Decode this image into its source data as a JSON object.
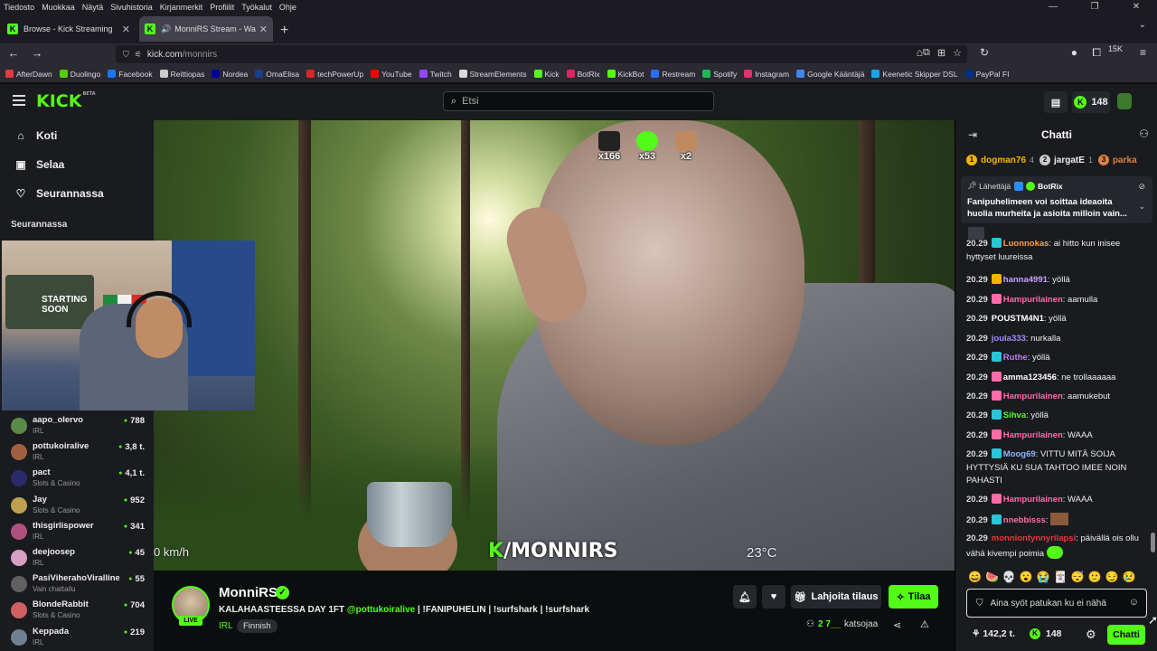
{
  "menubar": {
    "items": [
      "Tiedosto",
      "Muokkaa",
      "Näytä",
      "Sivuhistoria",
      "Kirjanmerkit",
      "Profiilit",
      "Työkalut",
      "Ohje"
    ]
  },
  "tabs": [
    {
      "title": "Browse - Kick Streaming",
      "active": false,
      "audio": false
    },
    {
      "title": "MonniRS Stream - Watch Li",
      "active": true,
      "audio": true
    }
  ],
  "navbar": {
    "url_host": "kick.com",
    "url_path": "/monnirs",
    "ext_badge": "15K"
  },
  "bookmarks": [
    {
      "label": "AfterDawn",
      "color": "#e23b3b"
    },
    {
      "label": "Duolingo",
      "color": "#58cc02"
    },
    {
      "label": "Facebook",
      "color": "#1877f2"
    },
    {
      "label": "Reittiopas",
      "color": "#cccccc"
    },
    {
      "label": "Nordea",
      "color": "#0000a0"
    },
    {
      "label": "OmaElisa",
      "color": "#1b3c8c"
    },
    {
      "label": "techPowerUp",
      "color": "#d62828"
    },
    {
      "label": "YouTube",
      "color": "#ff0000"
    },
    {
      "label": "Twitch",
      "color": "#9146ff"
    },
    {
      "label": "StreamElements",
      "color": "#d9d9d9"
    },
    {
      "label": "Kick",
      "color": "#53fc18"
    },
    {
      "label": "BotRix",
      "color": "#e0245e"
    },
    {
      "label": "KickBot",
      "color": "#53fc18"
    },
    {
      "label": "Restream",
      "color": "#2b6cff"
    },
    {
      "label": "Spotify",
      "color": "#1db954"
    },
    {
      "label": "Instagram",
      "color": "#e1306c"
    },
    {
      "label": "Google Kääntäjä",
      "color": "#4285f4"
    },
    {
      "label": "Keenetic Skipper DSL",
      "color": "#1aa3e8"
    },
    {
      "label": "PayPal FI",
      "color": "#003087"
    }
  ],
  "kick": {
    "logo": "KICK",
    "logo_tag": "BETA",
    "search_placeholder": "Etsi",
    "coin_count": "148",
    "accent": "#53fc18"
  },
  "sidebar": {
    "nav": [
      {
        "label": "Koti",
        "icon": "home-icon"
      },
      {
        "label": "Selaa",
        "icon": "browse-icon"
      },
      {
        "label": "Seurannassa",
        "icon": "heart-icon"
      }
    ],
    "following_title": "Seurannassa",
    "following": [
      {
        "name": "aapo_olervo",
        "category": "IRL",
        "viewers": "788",
        "color": "#5a8a4a"
      },
      {
        "name": "pottukoiralive",
        "category": "IRL",
        "viewers": "3,8 t.",
        "color": "#a06040"
      },
      {
        "name": "pact",
        "category": "Slots & Casino",
        "viewers": "4,1 t.",
        "color": "#2b2b6b"
      },
      {
        "name": "Jay",
        "category": "Slots & Casino",
        "viewers": "952",
        "color": "#c0a050"
      },
      {
        "name": "thisgirlispower",
        "category": "IRL",
        "viewers": "341",
        "color": "#b05080"
      },
      {
        "name": "deejoosep",
        "category": "IRL",
        "viewers": "45",
        "color": "#d8a0c0"
      },
      {
        "name": "PasiViherahoVirallinen",
        "category": "Vain chattailu",
        "viewers": "55",
        "color": "#606060"
      },
      {
        "name": "BlondeRabbit",
        "category": "Slots & Casino",
        "viewers": "704",
        "color": "#d06060"
      },
      {
        "name": "Keppada",
        "category": "IRL",
        "viewers": "219",
        "color": "#708090"
      }
    ]
  },
  "webcam": {
    "poster_text": "STARTING SOON"
  },
  "video": {
    "sub_badges": [
      {
        "count": "x166",
        "color": "#222"
      },
      {
        "count": "x53",
        "color": "#53fc18"
      },
      {
        "count": "x2",
        "color": "#c08a60"
      }
    ],
    "speed": "0 km/h",
    "temperature": "23°C",
    "watermark_slash": "/MONNIRS"
  },
  "stream": {
    "channel": "MonniRS",
    "live": "LIVE",
    "title_pre": "KALAHAASTEESSA DAY 1FT ",
    "title_mention": "@pottukoiralive",
    "title_post": " | !FANIPUHELIN | !surfshark | !surfshark",
    "category": "IRL",
    "language": "Finnish",
    "gift_label": "Lahjoita tilaus",
    "follow_label": "Tilaa",
    "viewers_prefix": "2",
    "viewers_count": "7__",
    "viewers_label": "katsojaa"
  },
  "chat": {
    "title": "Chatti",
    "leaders": [
      {
        "rank": "1",
        "name": "dogman76",
        "points": "4",
        "color": "#f5b400",
        "name_color": "#f5b400"
      },
      {
        "rank": "2",
        "name": "jargatE",
        "points": "1",
        "color": "#ccc",
        "name_color": "#eee"
      },
      {
        "rank": "3",
        "name": "parka",
        "points": "",
        "color": "#e08040",
        "name_color": "#e08040"
      }
    ],
    "pinned": {
      "sender_label": "Lähettäjä",
      "sender": "BotRix",
      "message": "Fanipuhelimeen voi soittaa ideaoita huolia murheita ja asioita milloin vain..."
    },
    "messages": [
      {
        "time": "20.29",
        "user": "Luonnokas",
        "color": "#ff9f43",
        "text": ": ai hitto kun inisee hyttyset luureissa",
        "badge": "#2bc5d8"
      },
      {
        "time": "20.29",
        "user": "hanna4991",
        "color": "#c7a0ff",
        "text": ": yöllä",
        "badge": "#f5b400"
      },
      {
        "time": "20.29",
        "user": "Hampurilainen",
        "color": "#ff6ba8",
        "text": ": aamulla",
        "badge": "#ff6ba8"
      },
      {
        "time": "20.29",
        "user": "POUSTM4N1",
        "color": "#ffffff",
        "text": ": yöllä",
        "badge": ""
      },
      {
        "time": "20.29",
        "user": "joula333",
        "color": "#a08cff",
        "text": ": nurkalla",
        "badge": ""
      },
      {
        "time": "20.29",
        "user": "Ruthe",
        "color": "#c07cff",
        "text": ": yöllä",
        "badge": "#2bc5d8"
      },
      {
        "time": "20.29",
        "user": "amma123456",
        "color": "#ffffff",
        "text": ": ne trollaaaaaa",
        "badge": "#ff6ba8"
      },
      {
        "time": "20.29",
        "user": "Hampurilainen",
        "color": "#ff6ba8",
        "text": ": aamukebut",
        "badge": "#ff6ba8"
      },
      {
        "time": "20.29",
        "user": "Sihva",
        "color": "#53fc18",
        "text": ": yöllä",
        "badge": "#2bc5d8"
      },
      {
        "time": "20.29",
        "user": "Hampurilainen",
        "color": "#ff6ba8",
        "text": ": WAAA",
        "badge": "#ff6ba8"
      },
      {
        "time": "20.29",
        "user": "Moog69",
        "color": "#8fb4ff",
        "text": ": VITTU MITÄ SOIJA HYTTYSIÄ KU SUA TAHTOO IMEE NOIN PAHASTI",
        "badge": "#2bc5d8"
      },
      {
        "time": "20.29",
        "user": "Hampurilainen",
        "color": "#ff6ba8",
        "text": ": WAAA",
        "badge": "#ff6ba8"
      },
      {
        "time": "20.29",
        "user": "nnebbisss",
        "color": "#ff6ba8",
        "text": ":",
        "badge": "#2bc5d8"
      },
      {
        "time": "20.29",
        "user": "monniontynnyrilapsi",
        "color": "#e03a3a",
        "text": ": päivällä ois ollu vähä kivempi poimia",
        "badge": ""
      }
    ],
    "emotes": [
      "😄",
      "🍉",
      "💀",
      "😮",
      "😭",
      "🃏",
      "😴",
      "🙂",
      "😏",
      "😢"
    ],
    "input_placeholder": "Aina syöt patukan ku ei nähä",
    "points": "142,2 t.",
    "coins": "148",
    "send_label": "Chatti"
  }
}
